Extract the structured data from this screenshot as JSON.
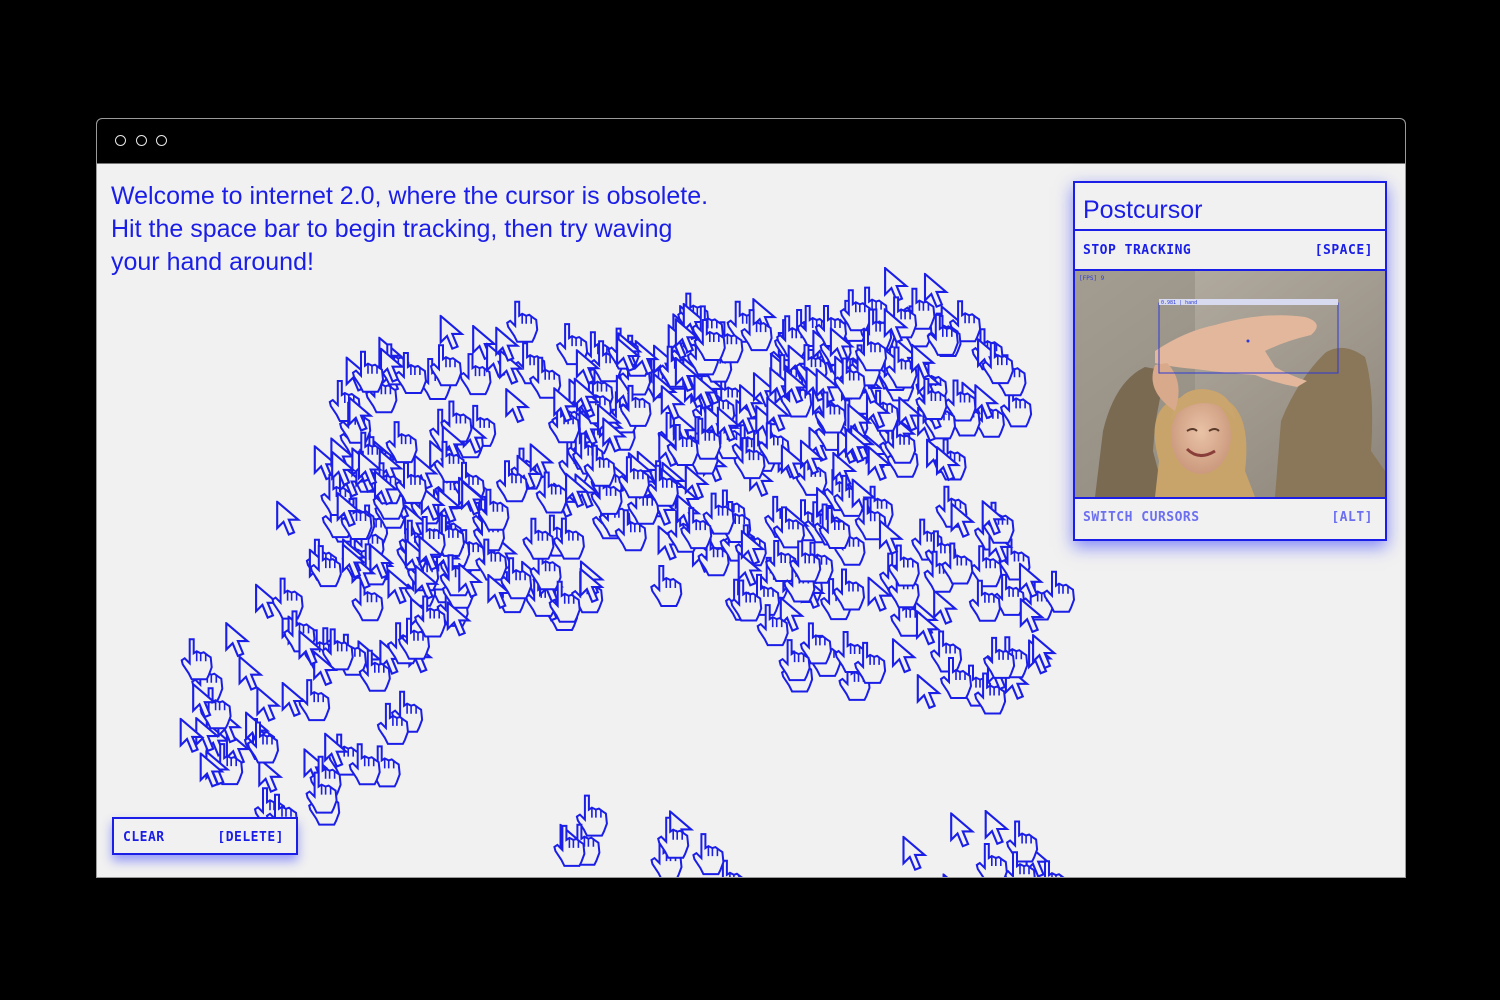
{
  "window": {
    "controls": [
      "window-dot-1",
      "window-dot-2",
      "window-dot-3"
    ]
  },
  "welcome": {
    "line1": "Welcome to internet 2.0, where the cursor is obsolete.",
    "line2": "Hit the space bar to begin tracking, then try waving",
    "line3": "your hand around!"
  },
  "clear_button": {
    "label": "CLEAR",
    "key": "[DELETE]"
  },
  "panel": {
    "title": "Postcursor",
    "stop_label": "STOP TRACKING",
    "stop_key": "[SPACE]",
    "camera": {
      "fps_label": "[FPS] 9",
      "detection_label": "0.981 | hand"
    },
    "switch_label": "SWITCH CURSORS",
    "switch_key": "[ALT]"
  },
  "colors": {
    "accent": "#1a1ee6",
    "background": "#f1f1f1",
    "frame": "#000000"
  },
  "icons": {
    "cursor_types": [
      "arrow-cursor-icon",
      "hand-pointer-icon"
    ]
  }
}
